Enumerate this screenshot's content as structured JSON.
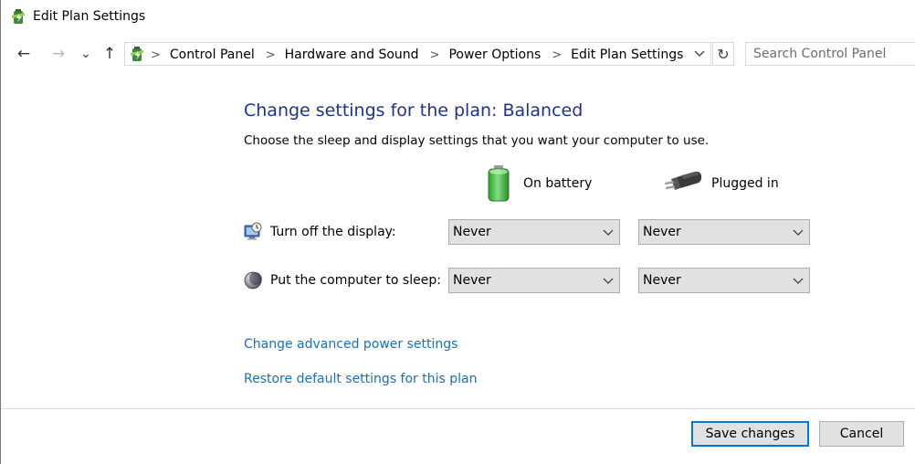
{
  "window": {
    "title": "Edit Plan Settings"
  },
  "nav": {
    "back_glyph": "←",
    "forward_glyph": "→",
    "recent_glyph": "⌄",
    "up_glyph": "↑",
    "breadcrumbs": [
      "Control Panel",
      "Hardware and Sound",
      "Power Options",
      "Edit Plan Settings"
    ],
    "separator": ">",
    "refresh_glyph": "↻",
    "search_placeholder": "Search Control Panel"
  },
  "main": {
    "heading": "Change settings for the plan: Balanced",
    "subheading": "Choose the sleep and display settings that you want your computer to use.",
    "columns": {
      "on_battery": "On battery",
      "plugged_in": "Plugged in"
    },
    "rows": {
      "display": {
        "label": "Turn off the display:",
        "on_battery": "Never",
        "plugged_in": "Never"
      },
      "sleep": {
        "label": "Put the computer to sleep:",
        "on_battery": "Never",
        "plugged_in": "Never"
      }
    },
    "links": {
      "advanced": "Change advanced power settings",
      "restore": "Restore default settings for this plan"
    }
  },
  "footer": {
    "save_label": "Save changes",
    "cancel_label": "Cancel"
  },
  "colors": {
    "heading": "#1e3287",
    "link": "#1a6fb5",
    "primary_button_border": "#0078d7",
    "battery_green": "#3fbf3f"
  },
  "icons": {
    "app": "power-options-icon",
    "display": "display-icon",
    "sleep": "sleep-moon-icon",
    "battery": "battery-icon",
    "plug": "power-plug-icon"
  }
}
